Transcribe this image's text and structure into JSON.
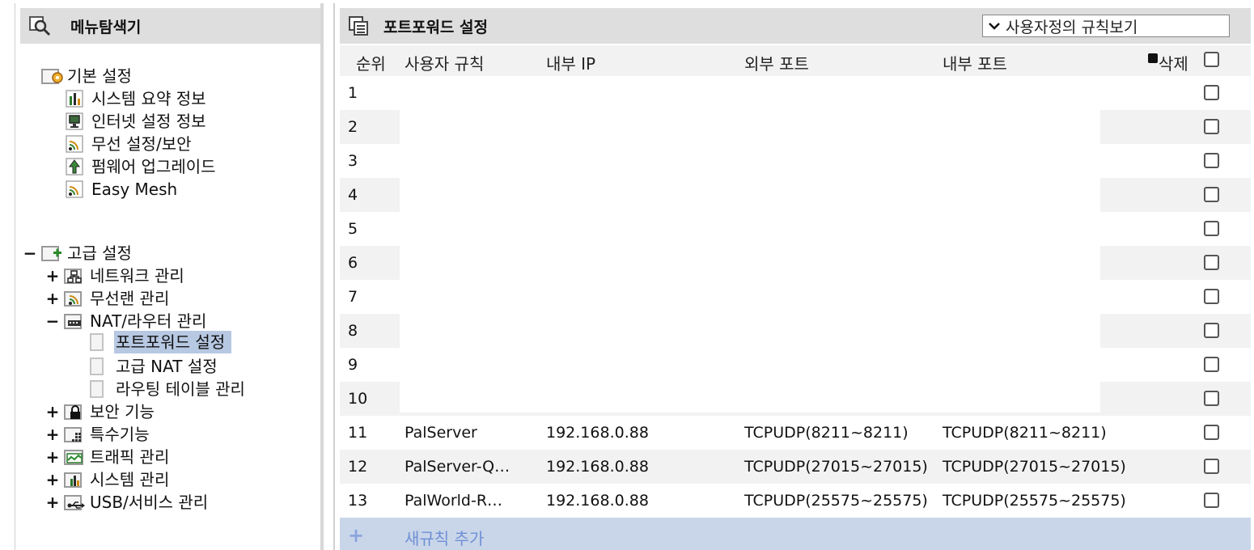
{
  "nav": {
    "title": "메뉴탐색기",
    "basic": {
      "label": "기본 설정",
      "items": [
        "시스템 요약 정보",
        "인터넷 설정 정보",
        "무선 설정/보안",
        "펌웨어 업그레이드",
        "Easy Mesh"
      ]
    },
    "advanced": {
      "toggle": "−",
      "label": "고급 설정",
      "groups": [
        {
          "toggle": "+",
          "label": "네트워크 관리"
        },
        {
          "toggle": "+",
          "label": "무선랜 관리"
        },
        {
          "toggle": "−",
          "label": "NAT/라우터 관리"
        },
        {
          "toggle": "+",
          "label": "보안 기능"
        },
        {
          "toggle": "+",
          "label": "특수기능"
        },
        {
          "toggle": "+",
          "label": "트래픽 관리"
        },
        {
          "toggle": "+",
          "label": "시스템 관리"
        },
        {
          "toggle": "+",
          "label": "USB/서비스 관리"
        }
      ],
      "nat_children": [
        "포트포워드 설정",
        "고급 NAT 설정",
        "라우팅 테이블 관리"
      ],
      "selected": "포트포워드 설정"
    }
  },
  "main": {
    "title": "포트포워드 설정",
    "view_select": "사용자정의 규칙보기",
    "columns": {
      "order": "순위",
      "rule": "사용자 규칙",
      "ip": "내부 IP",
      "ext_port": "외부 포트",
      "int_port": "내부 포트",
      "delete": "삭제"
    },
    "rows": [
      {
        "n": "1",
        "rule": "",
        "ip": "",
        "ext": "",
        "int": ""
      },
      {
        "n": "2",
        "rule": "",
        "ip": "",
        "ext": "",
        "int": ""
      },
      {
        "n": "3",
        "rule": "",
        "ip": "",
        "ext": "",
        "int": ""
      },
      {
        "n": "4",
        "rule": "",
        "ip": "",
        "ext": "",
        "int": ""
      },
      {
        "n": "5",
        "rule": "",
        "ip": "",
        "ext": "",
        "int": ""
      },
      {
        "n": "6",
        "rule": "",
        "ip": "",
        "ext": "",
        "int": ""
      },
      {
        "n": "7",
        "rule": "",
        "ip": "",
        "ext": "",
        "int": ""
      },
      {
        "n": "8",
        "rule": "",
        "ip": "",
        "ext": "",
        "int": ""
      },
      {
        "n": "9",
        "rule": "",
        "ip": "",
        "ext": "",
        "int": ""
      },
      {
        "n": "10",
        "rule": "",
        "ip": "",
        "ext": "",
        "int": ""
      },
      {
        "n": "11",
        "rule": "PalServer",
        "ip": "192.168.0.88",
        "ext": "TCPUDP(8211~8211)",
        "int": "TCPUDP(8211~8211)"
      },
      {
        "n": "12",
        "rule": "PalServer-Q…",
        "ip": "192.168.0.88",
        "ext": "TCPUDP(27015~27015)",
        "int": "TCPUDP(27015~27015)"
      },
      {
        "n": "13",
        "rule": "PalWorld-R…",
        "ip": "192.168.0.88",
        "ext": "TCPUDP(25575~25575)",
        "int": "TCPUDP(25575~25575)"
      }
    ],
    "add_rule": "새규칙 추가",
    "add_icon": "+"
  }
}
